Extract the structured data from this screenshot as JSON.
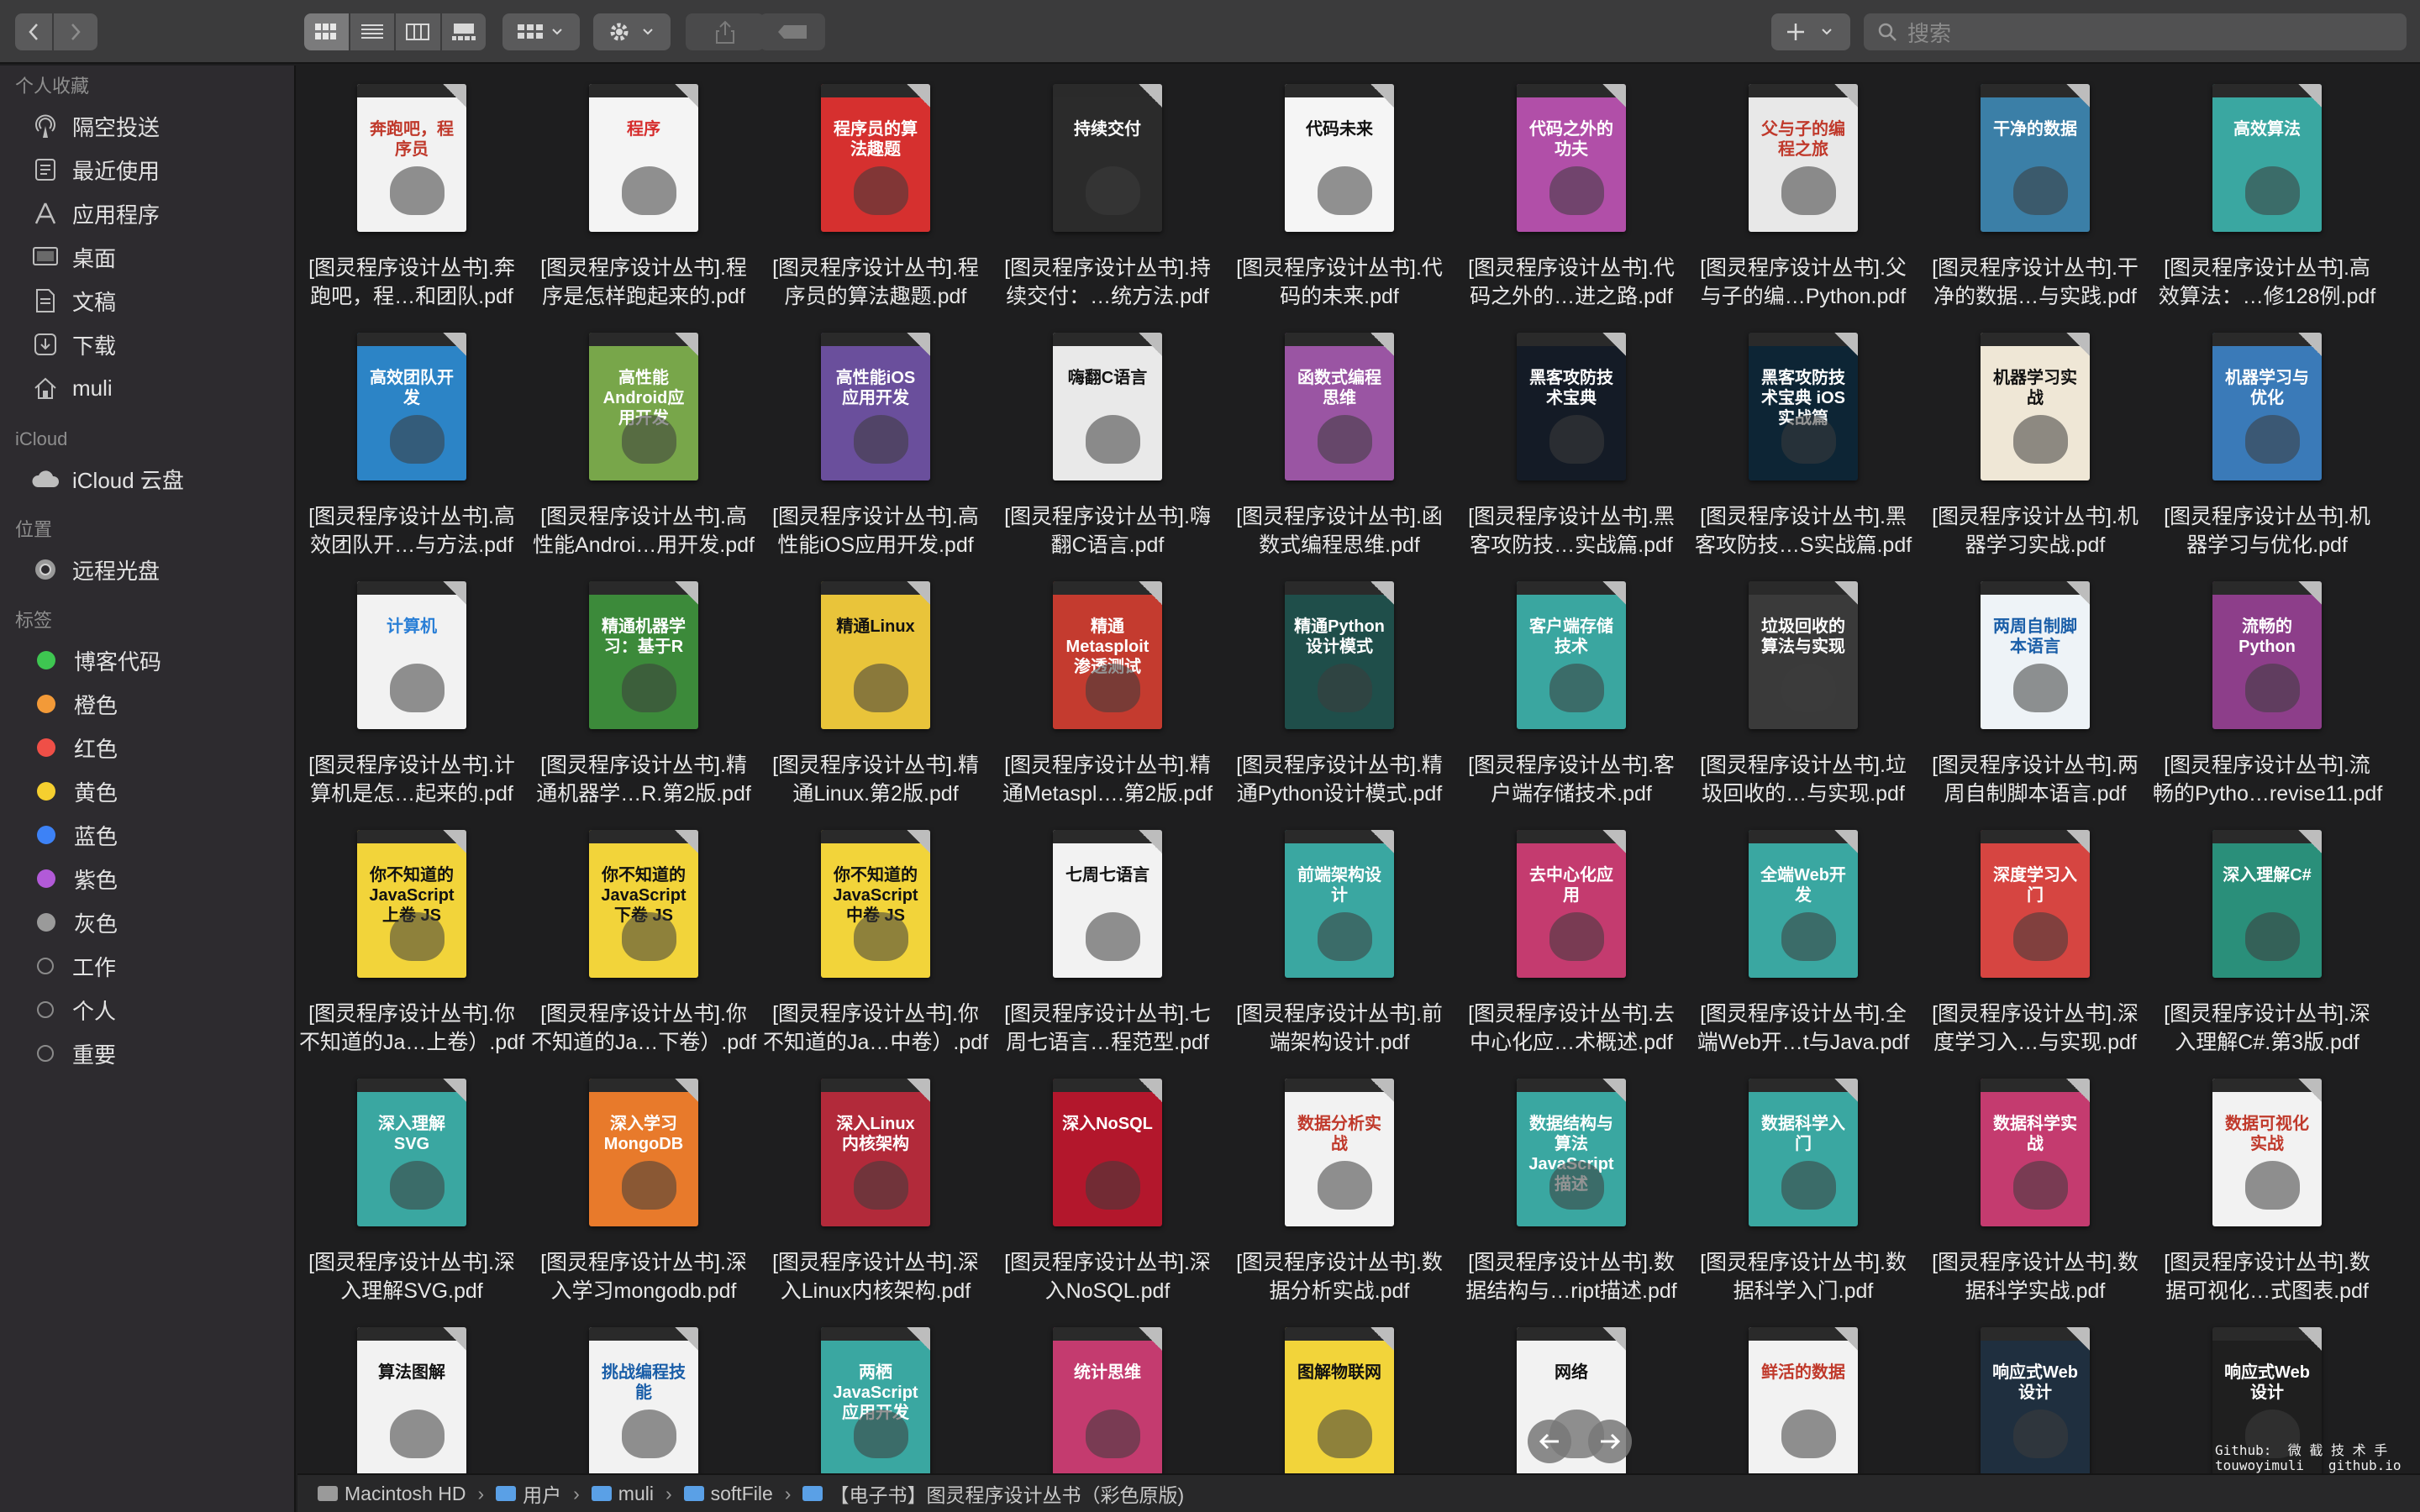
{
  "toolbar": {
    "back_icon": "chevron-left-icon",
    "forward_icon": "chevron-right-icon",
    "views": [
      "icon-view",
      "list-view",
      "column-view",
      "gallery-view"
    ],
    "active_view": "icon-view",
    "group_icon": "grid-dropdown-icon",
    "action_icon": "gear-icon",
    "share_icon": "share-icon",
    "tag_icon": "tag-icon",
    "new_icon": "plus-icon",
    "search_placeholder": "搜索"
  },
  "sidebar": {
    "favorites_title": "个人收藏",
    "favorites": [
      {
        "label": "隔空投送",
        "icon": "airdrop-icon"
      },
      {
        "label": "最近使用",
        "icon": "recents-icon"
      },
      {
        "label": "应用程序",
        "icon": "applications-icon"
      },
      {
        "label": "桌面",
        "icon": "desktop-icon"
      },
      {
        "label": "文稿",
        "icon": "documents-icon"
      },
      {
        "label": "下载",
        "icon": "downloads-icon"
      },
      {
        "label": "muli",
        "icon": "home-icon"
      }
    ],
    "icloud_title": "iCloud",
    "icloud": [
      {
        "label": "iCloud 云盘",
        "icon": "cloud-icon"
      }
    ],
    "locations_title": "位置",
    "locations": [
      {
        "label": "远程光盘",
        "icon": "disc-icon"
      }
    ],
    "tags_title": "标签",
    "tags": [
      {
        "label": "博客代码",
        "color": "#3ec651"
      },
      {
        "label": "橙色",
        "color": "#f39a38"
      },
      {
        "label": "红色",
        "color": "#ef4f47"
      },
      {
        "label": "黄色",
        "color": "#f5cf2f"
      },
      {
        "label": "蓝色",
        "color": "#3d82f6"
      },
      {
        "label": "紫色",
        "color": "#b25ad8"
      },
      {
        "label": "灰色",
        "color": "#9a9a9a"
      },
      {
        "label": "工作",
        "color": ""
      },
      {
        "label": "个人",
        "color": ""
      },
      {
        "label": "重要",
        "color": ""
      }
    ]
  },
  "files": [
    {
      "line1": "[图灵程序设计丛书].奔",
      "line2": "跑吧，程…和团队.pdf",
      "cover_title": "奔跑吧，程序员",
      "cover_color": "#f2f2f2",
      "title_color": "#c0392b"
    },
    {
      "line1": "[图灵程序设计丛书].程",
      "line2": "序是怎样跑起来的.pdf",
      "cover_title": "程序",
      "cover_color": "#f4f4f4",
      "title_color": "#d62d2d"
    },
    {
      "line1": "[图灵程序设计丛书].程",
      "line2": "序员的算法趣题.pdf",
      "cover_title": "程序员的算法趣题",
      "cover_color": "#d6302f",
      "title_color": "#ffffff"
    },
    {
      "line1": "[图灵程序设计丛书].持",
      "line2": "续交付：…统方法.pdf",
      "cover_title": "持续交付",
      "cover_color": "#2b2b2b",
      "title_color": "#ffffff"
    },
    {
      "line1": "[图灵程序设计丛书].代",
      "line2": "码的未来.pdf",
      "cover_title": "代码未来",
      "cover_color": "#f5f5f5",
      "title_color": "#111111"
    },
    {
      "line1": "[图灵程序设计丛书].代",
      "line2": "码之外的…进之路.pdf",
      "cover_title": "代码之外的功夫",
      "cover_color": "#b14fa8",
      "title_color": "#ffffff"
    },
    {
      "line1": "[图灵程序设计丛书].父",
      "line2": "与子的编…Python.pdf",
      "cover_title": "父与子的编程之旅",
      "cover_color": "#e8e8e8",
      "title_color": "#c0392b"
    },
    {
      "line1": "[图灵程序设计丛书].干",
      "line2": "净的数据…与实践.pdf",
      "cover_title": "干净的数据",
      "cover_color": "#3b7fa7",
      "title_color": "#ffffff"
    },
    {
      "line1": "[图灵程序设计丛书].高",
      "line2": "效算法：…修128例.pdf",
      "cover_title": "高效算法",
      "cover_color": "#3aa7a1",
      "title_color": "#ffffff"
    },
    {
      "line1": "[图灵程序设计丛书].高",
      "line2": "效团队开…与方法.pdf",
      "cover_title": "高效团队开发",
      "cover_color": "#2c84c6",
      "title_color": "#ffffff"
    },
    {
      "line1": "[图灵程序设计丛书].高",
      "line2": "性能Androi…用开发.pdf",
      "cover_title": "高性能Android应用开发",
      "cover_color": "#78a64a",
      "title_color": "#ffffff"
    },
    {
      "line1": "[图灵程序设计丛书].高",
      "line2": "性能iOS应用开发.pdf",
      "cover_title": "高性能iOS应用开发",
      "cover_color": "#6a4f9c",
      "title_color": "#ffffff"
    },
    {
      "line1": "[图灵程序设计丛书].嗨",
      "line2": "翻C语言.pdf",
      "cover_title": "嗨翻C语言",
      "cover_color": "#e9e9e9",
      "title_color": "#111111"
    },
    {
      "line1": "[图灵程序设计丛书].函",
      "line2": "数式编程思维.pdf",
      "cover_title": "函数式编程思维",
      "cover_color": "#9a55a3",
      "title_color": "#ffffff"
    },
    {
      "line1": "[图灵程序设计丛书].黑",
      "line2": "客攻防技…实战篇.pdf",
      "cover_title": "黑客攻防技术宝典",
      "cover_color": "#141b26",
      "title_color": "#ffffff"
    },
    {
      "line1": "[图灵程序设计丛书].黑",
      "line2": "客攻防技…S实战篇.pdf",
      "cover_title": "黑客攻防技术宝典 iOS实战篇",
      "cover_color": "#0d2535",
      "title_color": "#ffffff"
    },
    {
      "line1": "[图灵程序设计丛书].机",
      "line2": "器学习实战.pdf",
      "cover_title": "机器学习实战",
      "cover_color": "#efe7d6",
      "title_color": "#111111"
    },
    {
      "line1": "[图灵程序设计丛书].机",
      "line2": "器学习与优化.pdf",
      "cover_title": "机器学习与优化",
      "cover_color": "#3a7ab8",
      "title_color": "#ffffff"
    },
    {
      "line1": "[图灵程序设计丛书].计",
      "line2": "算机是怎…起来的.pdf",
      "cover_title": "计算机",
      "cover_color": "#f2f2f2",
      "title_color": "#2a7fd6"
    },
    {
      "line1": "[图灵程序设计丛书].精",
      "line2": "通机器学…R.第2版.pdf",
      "cover_title": "精通机器学习：基于R",
      "cover_color": "#3c8a3a",
      "title_color": "#ffffff"
    },
    {
      "line1": "[图灵程序设计丛书].精",
      "line2": "通Linux.第2版.pdf",
      "cover_title": "精通Linux",
      "cover_color": "#e9c43a",
      "title_color": "#111111"
    },
    {
      "line1": "[图灵程序设计丛书].精",
      "line2": "通Metaspl….第2版.pdf",
      "cover_title": "精通Metasploit渗透测试",
      "cover_color": "#c43b2f",
      "title_color": "#ffffff"
    },
    {
      "line1": "[图灵程序设计丛书].精",
      "line2": "通Python设计模式.pdf",
      "cover_title": "精通Python设计模式",
      "cover_color": "#1f4e4a",
      "title_color": "#ffffff"
    },
    {
      "line1": "[图灵程序设计丛书].客",
      "line2": "户端存储技术.pdf",
      "cover_title": "客户端存储技术",
      "cover_color": "#3aa6a0",
      "title_color": "#ffffff"
    },
    {
      "line1": "[图灵程序设计丛书].垃",
      "line2": "圾回收的…与实现.pdf",
      "cover_title": "垃圾回收的算法与实现",
      "cover_color": "#3a3a3a",
      "title_color": "#ffffff"
    },
    {
      "line1": "[图灵程序设计丛书].两",
      "line2": "周自制脚本语言.pdf",
      "cover_title": "两周自制脚本语言",
      "cover_color": "#eef3f7",
      "title_color": "#1a5ea8"
    },
    {
      "line1": "[图灵程序设计丛书].流",
      "line2": "畅的Pytho…revise11.pdf",
      "cover_title": "流畅的Python",
      "cover_color": "#8d3e8a",
      "title_color": "#ffffff"
    },
    {
      "line1": "[图灵程序设计丛书].你",
      "line2": "不知道的Ja…上卷）.pdf",
      "cover_title": "你不知道的JavaScript 上卷 JS",
      "cover_color": "#f2d43a",
      "title_color": "#111111"
    },
    {
      "line1": "[图灵程序设计丛书].你",
      "line2": "不知道的Ja…下卷）.pdf",
      "cover_title": "你不知道的JavaScript 下卷 JS",
      "cover_color": "#f2d43a",
      "title_color": "#111111"
    },
    {
      "line1": "[图灵程序设计丛书].你",
      "line2": "不知道的Ja…中卷）.pdf",
      "cover_title": "你不知道的JavaScript 中卷 JS",
      "cover_color": "#f2d43a",
      "title_color": "#111111"
    },
    {
      "line1": "[图灵程序设计丛书].七",
      "line2": "周七语言…程范型.pdf",
      "cover_title": "七周七语言",
      "cover_color": "#f2f2f2",
      "title_color": "#111111"
    },
    {
      "line1": "[图灵程序设计丛书].前",
      "line2": "端架构设计.pdf",
      "cover_title": "前端架构设计",
      "cover_color": "#3aa7a1",
      "title_color": "#ffffff"
    },
    {
      "line1": "[图灵程序设计丛书].去",
      "line2": "中心化应…术概述.pdf",
      "cover_title": "去中心化应用",
      "cover_color": "#c43b6f",
      "title_color": "#ffffff"
    },
    {
      "line1": "[图灵程序设计丛书].全",
      "line2": "端Web开…t与Java.pdf",
      "cover_title": "全端Web开发",
      "cover_color": "#3aa7a1",
      "title_color": "#ffffff"
    },
    {
      "line1": "[图灵程序设计丛书].深",
      "line2": "度学习入…与实现.pdf",
      "cover_title": "深度学习入门",
      "cover_color": "#d64541",
      "title_color": "#ffffff"
    },
    {
      "line1": "[图灵程序设计丛书].深",
      "line2": "入理解C#.第3版.pdf",
      "cover_title": "深入理解C#",
      "cover_color": "#2a8f7a",
      "title_color": "#ffffff"
    },
    {
      "line1": "[图灵程序设计丛书].深",
      "line2": "入理解SVG.pdf",
      "cover_title": "深入理解SVG",
      "cover_color": "#3aa7a1",
      "title_color": "#ffffff"
    },
    {
      "line1": "[图灵程序设计丛书].深",
      "line2": "入学习mongodb.pdf",
      "cover_title": "深入学习MongoDB",
      "cover_color": "#e87a2b",
      "title_color": "#ffffff"
    },
    {
      "line1": "[图灵程序设计丛书].深",
      "line2": "入Linux内核架构.pdf",
      "cover_title": "深入Linux内核架构",
      "cover_color": "#b22a3a",
      "title_color": "#ffffff"
    },
    {
      "line1": "[图灵程序设计丛书].深",
      "line2": "入NoSQL.pdf",
      "cover_title": "深入NoSQL",
      "cover_color": "#b3172c",
      "title_color": "#ffffff"
    },
    {
      "line1": "[图灵程序设计丛书].数",
      "line2": "据分析实战.pdf",
      "cover_title": "数据分析实战",
      "cover_color": "#f2f2f2",
      "title_color": "#c0392b"
    },
    {
      "line1": "[图灵程序设计丛书].数",
      "line2": "据结构与…ript描述.pdf",
      "cover_title": "数据结构与算法JavaScript描述",
      "cover_color": "#3aa7a1",
      "title_color": "#ffffff"
    },
    {
      "line1": "[图灵程序设计丛书].数",
      "line2": "据科学入门.pdf",
      "cover_title": "数据科学入门",
      "cover_color": "#3aa7a1",
      "title_color": "#ffffff"
    },
    {
      "line1": "[图灵程序设计丛书].数",
      "line2": "据科学实战.pdf",
      "cover_title": "数据科学实战",
      "cover_color": "#c43b6f",
      "title_color": "#ffffff"
    },
    {
      "line1": "[图灵程序设计丛书].数",
      "line2": "据可视化…式图表.pdf",
      "cover_title": "数据可视化实战",
      "cover_color": "#f2f2f2",
      "title_color": "#c0392b"
    },
    {
      "line1": "",
      "line2": "",
      "cover_title": "算法图解",
      "cover_color": "#f2f2f2",
      "title_color": "#111111"
    },
    {
      "line1": "",
      "line2": "",
      "cover_title": "挑战编程技能",
      "cover_color": "#f2f2f2",
      "title_color": "#1a5ea8"
    },
    {
      "line1": "",
      "line2": "",
      "cover_title": "两栖JavaScript应用开发",
      "cover_color": "#3aa7a1",
      "title_color": "#ffffff"
    },
    {
      "line1": "",
      "line2": "",
      "cover_title": "统计思维",
      "cover_color": "#c43b6f",
      "title_color": "#ffffff"
    },
    {
      "line1": "",
      "line2": "",
      "cover_title": "图解物联网",
      "cover_color": "#f2d43a",
      "title_color": "#111111"
    },
    {
      "line1": "",
      "line2": "",
      "cover_title": "网络",
      "cover_color": "#f2f2f2",
      "title_color": "#111111"
    },
    {
      "line1": "",
      "line2": "",
      "cover_title": "鲜活的数据",
      "cover_color": "#f2f2f2",
      "title_color": "#c0392b"
    },
    {
      "line1": "",
      "line2": "",
      "cover_title": "响应式Web设计",
      "cover_color": "#1f2f3f",
      "title_color": "#ffffff"
    },
    {
      "line1": "",
      "line2": "",
      "cover_title": "响应式Web设计",
      "cover_color": "#1f1f1f",
      "title_color": "#ffffff"
    }
  ],
  "pathbar": {
    "crumbs": [
      "Macintosh HD",
      "用户",
      "muli",
      "softFile",
      "【电子书】图灵程序设计丛书（彩色原版)"
    ]
  },
  "overlay": {
    "prev_icon": "arrow-left-icon",
    "next_icon": "arrow-right-icon",
    "watermark": "Github:  微 截 技 术 手\ntouwoyimuli   github.io"
  }
}
